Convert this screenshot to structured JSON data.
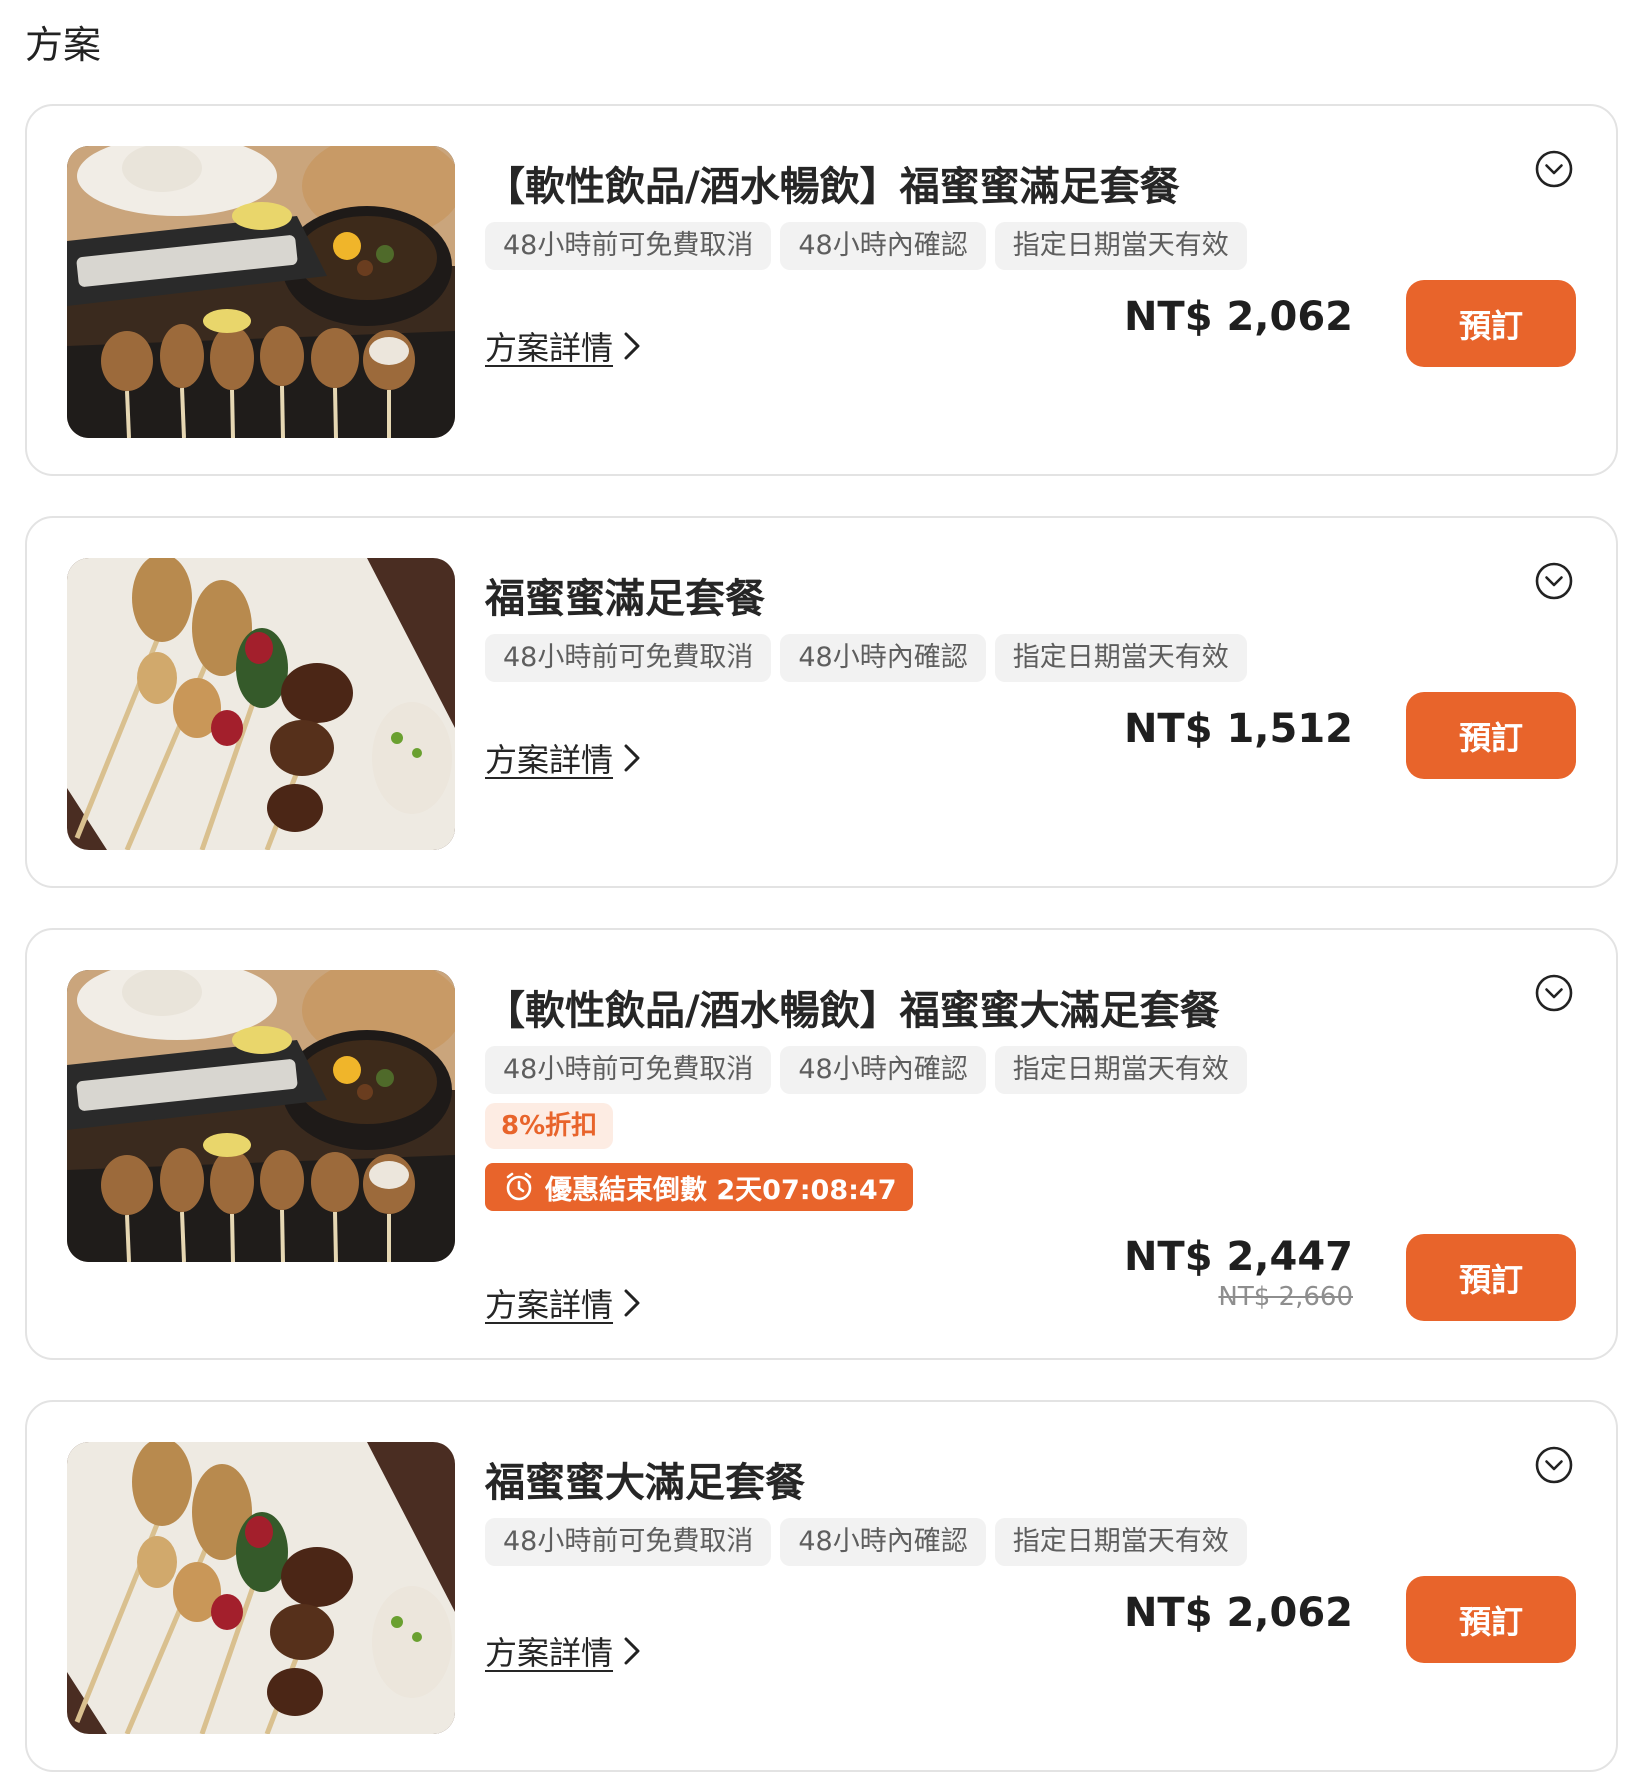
{
  "section_title": "方案",
  "plans": [
    {
      "title": "【軟性飲品/酒水暢飲】福蜜蜜滿足套餐",
      "tags": [
        "48小時前可免費取消",
        "48小時內確認",
        "指定日期當天有效"
      ],
      "details_label": "方案詳情",
      "price": "NT$ 2,062",
      "book_label": "預訂",
      "image": "yakitori-set-with-drinks"
    },
    {
      "title": "福蜜蜜滿足套餐",
      "tags": [
        "48小時前可免費取消",
        "48小時內確認",
        "指定日期當天有效"
      ],
      "details_label": "方案詳情",
      "price": "NT$ 1,512",
      "book_label": "預訂",
      "image": "yakitori-skewers-plate"
    },
    {
      "title": "【軟性飲品/酒水暢飲】福蜜蜜大滿足套餐",
      "tags": [
        "48小時前可免費取消",
        "48小時內確認",
        "指定日期當天有效"
      ],
      "discount": "8%折扣",
      "countdown": "優惠結束倒數 2天07:08:47",
      "details_label": "方案詳情",
      "price": "NT$ 2,447",
      "old_price": "NT$ 2,660",
      "book_label": "預訂",
      "image": "yakitori-set-with-drinks"
    },
    {
      "title": "福蜜蜜大滿足套餐",
      "tags": [
        "48小時前可免費取消",
        "48小時內確認",
        "指定日期當天有效"
      ],
      "details_label": "方案詳情",
      "price": "NT$ 2,062",
      "book_label": "預訂",
      "image": "yakitori-skewers-plate"
    }
  ],
  "colors": {
    "accent": "#e8642b",
    "tag_bg": "#f2f2f2",
    "discount_bg": "#fdece3",
    "card_border": "#e3e3e3"
  },
  "icons": {
    "expand": "chevron-down-circle-icon",
    "details": "chevron-right-icon",
    "countdown": "alarm-clock-icon"
  }
}
